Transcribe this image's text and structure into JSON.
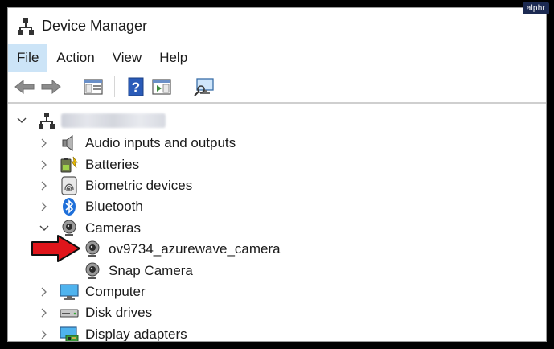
{
  "badge": {
    "text": "alphr"
  },
  "window": {
    "title": "Device Manager"
  },
  "menu": [
    {
      "label": "File"
    },
    {
      "label": "Action"
    },
    {
      "label": "View"
    },
    {
      "label": "Help"
    }
  ],
  "tree": {
    "categories": [
      {
        "label": "Audio inputs and outputs",
        "icon": "speaker-icon",
        "expanded": false
      },
      {
        "label": "Batteries",
        "icon": "battery-icon",
        "expanded": false
      },
      {
        "label": "Biometric devices",
        "icon": "fingerprint-icon",
        "expanded": false
      },
      {
        "label": "Bluetooth",
        "icon": "bluetooth-icon",
        "expanded": false
      },
      {
        "label": "Cameras",
        "icon": "camera-icon",
        "expanded": true,
        "children": [
          {
            "label": "ov9734_azurewave_camera",
            "icon": "camera-icon"
          },
          {
            "label": "Snap Camera",
            "icon": "camera-icon"
          }
        ]
      },
      {
        "label": "Computer",
        "icon": "monitor-icon",
        "expanded": false
      },
      {
        "label": "Disk drives",
        "icon": "disk-drive-icon",
        "expanded": false
      },
      {
        "label": "Display adapters",
        "icon": "display-adapter-icon",
        "expanded": false
      }
    ]
  },
  "colors": {
    "menu_active": "#cce4f7",
    "arrow": "#e0151b",
    "bluetooth": "#1e6fd9"
  }
}
